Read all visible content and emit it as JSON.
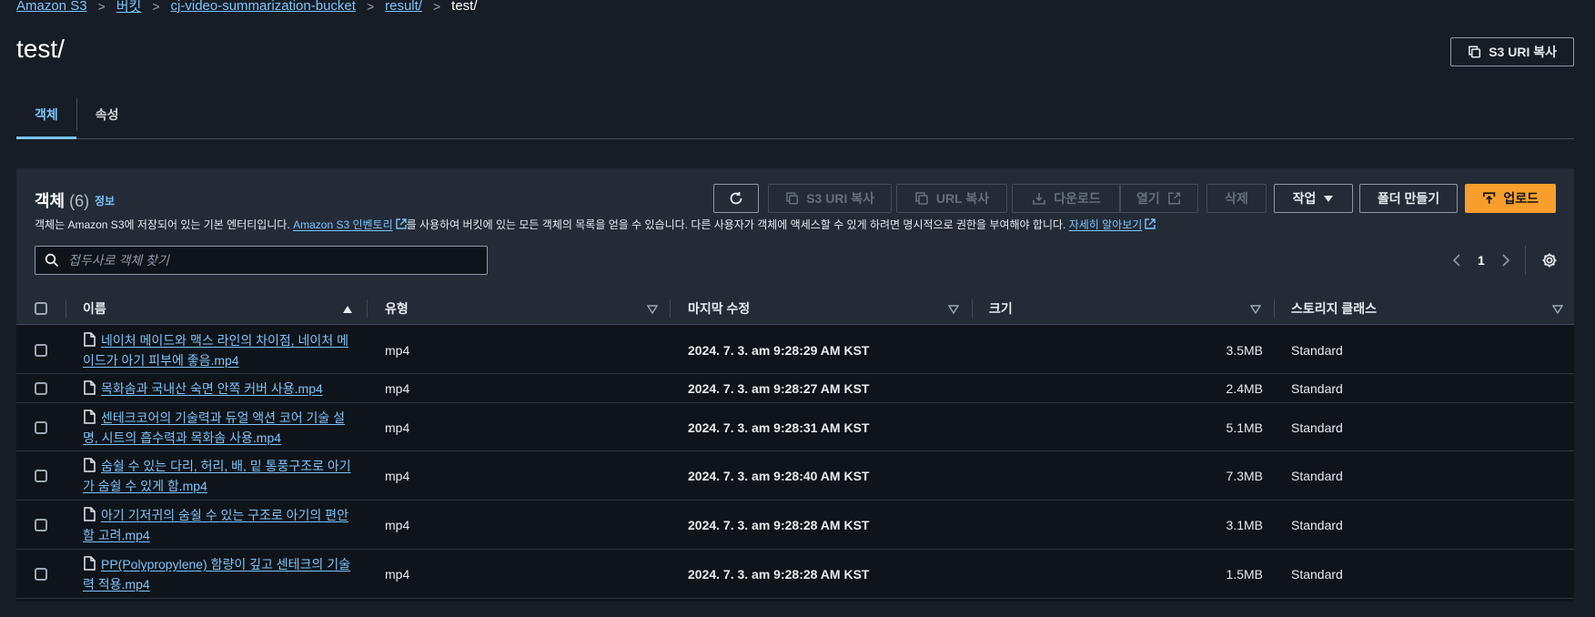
{
  "breadcrumb": {
    "items": [
      "Amazon S3",
      "버킷",
      "cj-video-summarization-bucket",
      "result/"
    ],
    "current": "test/"
  },
  "page_title": "test/",
  "top_copy_uri_label": "S3 URI 복사",
  "tabs": [
    {
      "label": "객체",
      "active": true
    },
    {
      "label": "속성",
      "active": false
    }
  ],
  "objects": {
    "title": "객체",
    "count": "(6)",
    "info_label": "정보",
    "desc_pre": "객체는 Amazon S3에 저장되어 있는 기본 엔터티입니다.",
    "inventory_link": "Amazon S3 인벤토리",
    "desc_post": "를 사용하여 버킷에 있는 모든 객체의 목록을 얻을 수 있습니다. 다른 사용자가 객체에 액세스할 수 있게 하려면 명시적으로 권한을 부여해야 합니다.",
    "learn_more": "자세히 알아보기",
    "toolbar": {
      "copy_s3_uri": "S3 URI 복사",
      "copy_url": "URL 복사",
      "download": "다운로드",
      "open": "열기",
      "delete": "삭제",
      "actions": "작업",
      "create_folder": "폴더 만들기",
      "upload": "업로드"
    },
    "search_placeholder": "접두사로 객체 찾기",
    "page_number": "1",
    "columns": [
      "이름",
      "유형",
      "마지막 수정",
      "크기",
      "스토리지 클래스"
    ],
    "rows": [
      {
        "name": "네이처 메이드와 맥스 라인의 차이점, 네이처 메이드가 아기 피부에 좋음.mp4",
        "type": "mp4",
        "modified": "2024. 7. 3. am 9:28:29 AM KST",
        "size": "3.5MB",
        "storage": "Standard"
      },
      {
        "name": "목화솜과 국내산 숙면 안쪽 커버 사용.mp4",
        "type": "mp4",
        "modified": "2024. 7. 3. am 9:28:27 AM KST",
        "size": "2.4MB",
        "storage": "Standard"
      },
      {
        "name": "센테크코어의 기술력과 듀얼 액션 코어 기술 설명, 시트의 흡수력과 목화솜 사용.mp4",
        "type": "mp4",
        "modified": "2024. 7. 3. am 9:28:31 AM KST",
        "size": "5.1MB",
        "storage": "Standard"
      },
      {
        "name": "숨쉴 수 있는 다리, 허리, 배, 밑 통풍구조로 아기가 숨쉴 수 있게 함.mp4",
        "type": "mp4",
        "modified": "2024. 7. 3. am 9:28:40 AM KST",
        "size": "7.3MB",
        "storage": "Standard"
      },
      {
        "name": "아기 기저귀의 숨쉴 수 있는 구조로 아기의 편안함 고려.mp4",
        "type": "mp4",
        "modified": "2024. 7. 3. am 9:28:28 AM KST",
        "size": "3.1MB",
        "storage": "Standard"
      },
      {
        "name": "PP(Polypropylene) 함량이 깊고 센테크의 기술력 적용.mp4",
        "type": "mp4",
        "modified": "2024. 7. 3. am 9:28:28 AM KST",
        "size": "1.5MB",
        "storage": "Standard"
      }
    ]
  },
  "colors": {
    "background": "#161d26",
    "panel": "#0f141a",
    "header": "#232b37",
    "link": "#7cc4f8",
    "primary": "#f89e2c"
  }
}
